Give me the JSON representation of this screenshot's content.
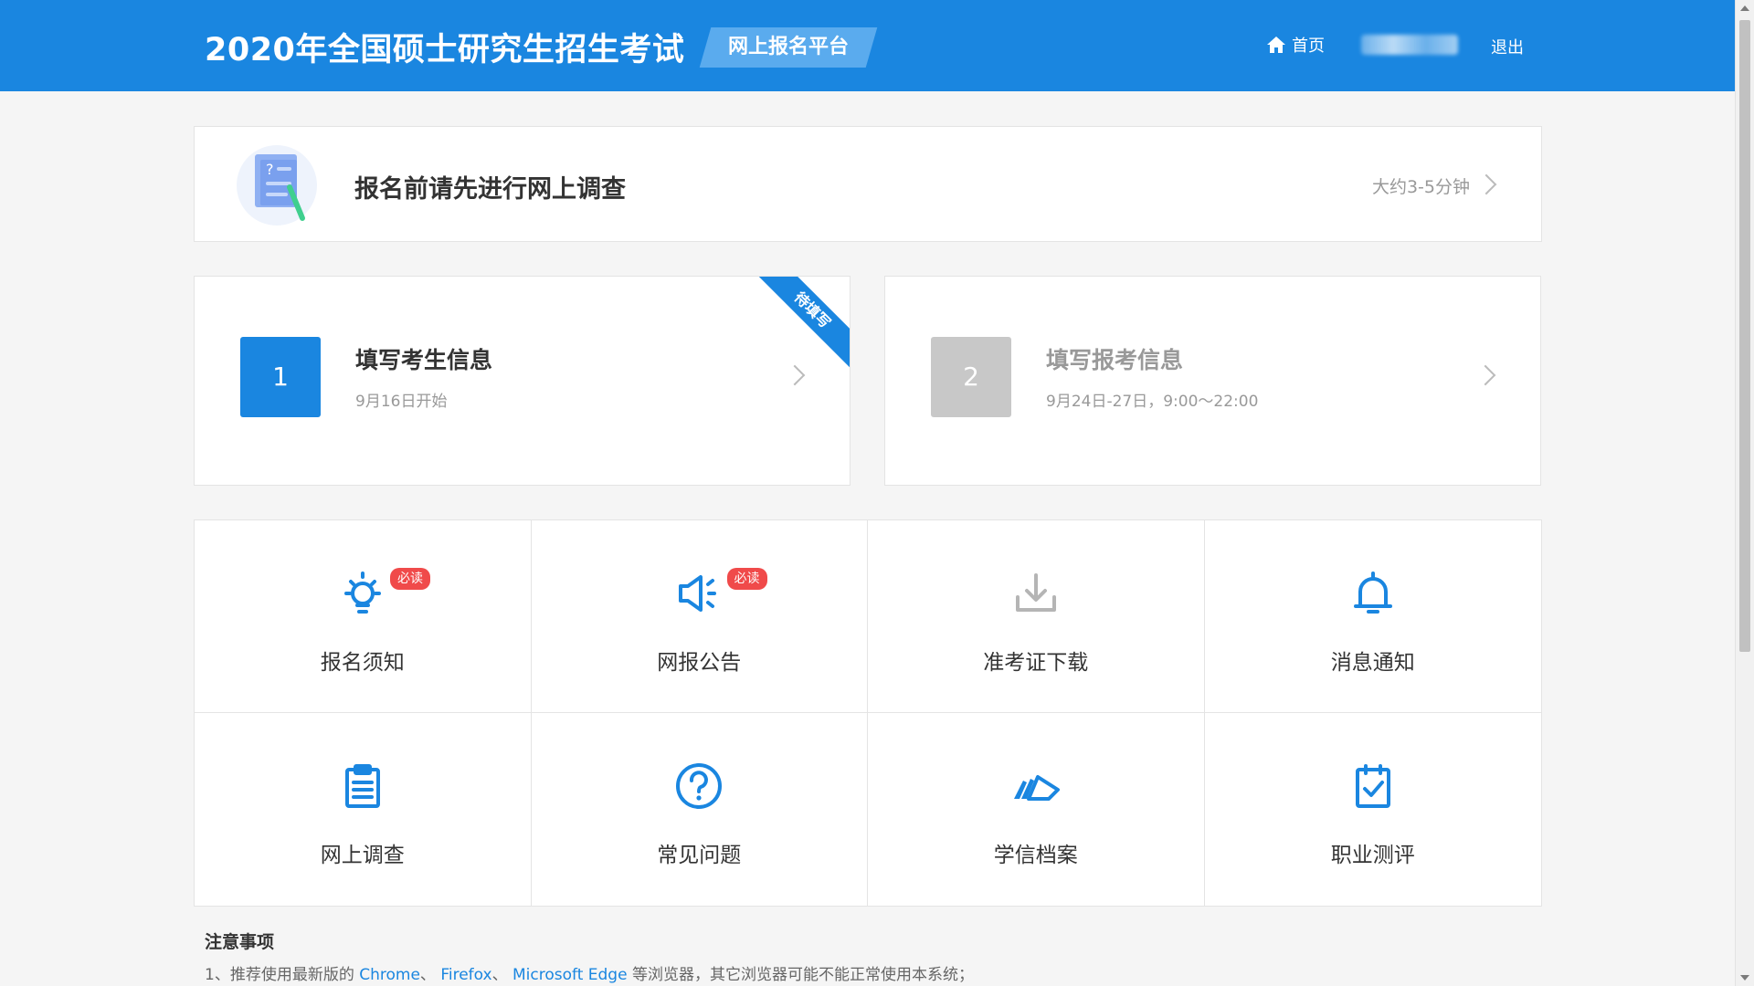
{
  "header": {
    "title": "2020年全国硕士研究生招生考试",
    "platform": "网上报名平台",
    "nav": {
      "home": "首页",
      "logout": "退出"
    }
  },
  "survey": {
    "title": "报名前请先进行网上调查",
    "duration": "大约3-5分钟"
  },
  "steps": [
    {
      "number": "1",
      "title": "填写考生信息",
      "date": "9月16日开始",
      "ribbon": "待填写"
    },
    {
      "number": "2",
      "title": "填写报考信息",
      "date": "9月24日-27日，9:00～22:00"
    }
  ],
  "tiles": [
    {
      "label": "报名须知",
      "icon": "lightbulb-icon",
      "badge": "必读"
    },
    {
      "label": "网报公告",
      "icon": "megaphone-icon",
      "badge": "必读"
    },
    {
      "label": "准考证下载",
      "icon": "download-icon"
    },
    {
      "label": "消息通知",
      "icon": "bell-icon"
    },
    {
      "label": "网上调查",
      "icon": "clipboard-icon"
    },
    {
      "label": "常见问题",
      "icon": "question-icon"
    },
    {
      "label": "学信档案",
      "icon": "archive-icon"
    },
    {
      "label": "职业测评",
      "icon": "clipboard-check-icon"
    }
  ],
  "notes": {
    "title": "注意事项",
    "line1": {
      "prefix": "1、推荐使用最新版的 ",
      "browser1": "Chrome",
      "sep1": "、 ",
      "browser2": "Firefox",
      "sep2": "、 ",
      "browser3": "Microsoft Edge",
      "suffix": " 等浏览器，其它浏览器可能不能正常使用本系统；"
    }
  },
  "colors": {
    "primary": "#1a86e0",
    "badge": "#f04a4a",
    "disabled": "#c8c8c8",
    "icon_muted": "#b5b5b5"
  }
}
